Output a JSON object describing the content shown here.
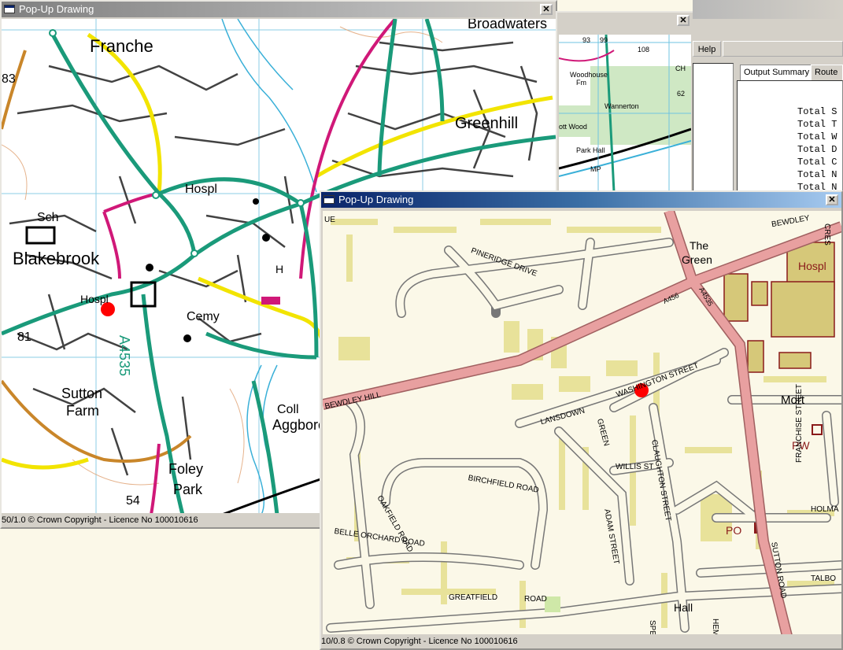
{
  "windows": {
    "left": {
      "title": "Pop-Up Drawing",
      "close_glyph": "✕",
      "status": "50/1.0  © Crown Copyright - Licence No 100010616",
      "labels": {
        "franche": "Franche",
        "broadwaters": "Broadwaters",
        "greenhill": "Greenhill",
        "hospl": "Hospl",
        "sch": "Sch",
        "blakebrook": "Blakebrook",
        "hospl2": "Hospl",
        "cemy": "Cemy",
        "a4535": "A4535",
        "sutton_farm": "Sutton\nFarm",
        "sutton": "Sutton",
        "farm": "Farm",
        "foley": "Foley",
        "park": "Park",
        "coll": "Coll",
        "aggborough": "Aggboro",
        "h": "H",
        "num83": "83",
        "num81": "81",
        "num54": "54"
      }
    },
    "middle": {
      "menu_help": "Help",
      "labels": {
        "woodhouse": "Woodhouse",
        "fm": "Fm",
        "wannerton": "Wannerton",
        "ott_wood": "ott Wood",
        "park_hall": "Park Hall",
        "mp": "MP",
        "n93": "93",
        "n99": "99",
        "n108": "108",
        "ch": "CH",
        "n62": "62"
      }
    },
    "right_panel": {
      "tabs": [
        "Output Summary",
        "Route S"
      ],
      "summary_lines": [
        "Total S",
        "Total T",
        "Total W",
        "Total D",
        "Total C",
        "Total N",
        "Total N"
      ]
    },
    "front": {
      "title": "Pop-Up Drawing",
      "close_glyph": "✕",
      "status": "10/0.8  © Crown Copyright - Licence No 100010616",
      "labels": {
        "the_green": "The\nGreen",
        "the": "The",
        "green": "Green",
        "hospl": "Hospl",
        "bewdley": "BEWDLEY",
        "pineridge": "PINERIDGE DRIVE",
        "a456": "A456",
        "a4535": "A4535",
        "bewdley_hill": "BEWDLEY HILL",
        "washington": "WASHINGTON STREET",
        "lansdown": "LANSDOWN",
        "green_rd": "GREEN",
        "mort": "Mort",
        "pw": "PW",
        "franchise": "FRANCHISE STREET",
        "willis": "WILLIS ST",
        "claughton": "CLAUGHTON STREET",
        "birchfield": "BIRCHFIELD ROAD",
        "oakfield": "OAKFIELD ROAD",
        "belle_orchard": "BELLE ORCHARD ROAD",
        "adam": "ADAM STREET",
        "po": "PO",
        "sutton_road": "SUTTON ROAD",
        "holman": "HOLMA",
        "talbot": "TALBO",
        "greatfield": "GREATFIELD",
        "road": "ROAD",
        "hall": "Hall",
        "spen": "SPEN",
        "hemm": "HEMM",
        "ue": "UE",
        "cres": "CRES"
      }
    }
  },
  "colors": {
    "os_background": "#ffffff",
    "os_green_road": "#1a9a7a",
    "os_yellow_road": "#f2e400",
    "os_magenta_road": "#d01878",
    "os_water": "#3ab0d8",
    "street_background": "#fbf8e8",
    "street_building": "#e8e29a",
    "street_major_road": "#e8a0a0",
    "marker": "#ff0000"
  }
}
